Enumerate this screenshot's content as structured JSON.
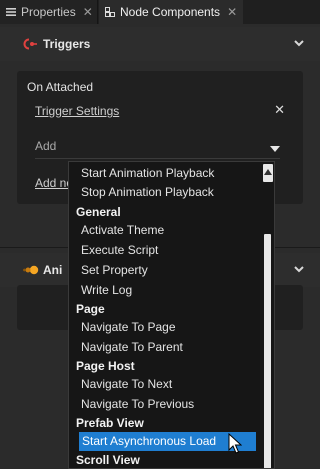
{
  "tabs": [
    {
      "label": "Properties",
      "close": "✕",
      "active": false
    },
    {
      "label": "Node Components",
      "close": "✕",
      "active": true
    }
  ],
  "triggers_section": {
    "title": "Triggers",
    "card": {
      "event": "On Attached",
      "trigger_settings_link": "Trigger Settings",
      "remove_glyph": "✕",
      "add_select_value": "Add",
      "add_link": "Add no"
    }
  },
  "animations_section": {
    "title": "Ani"
  },
  "dropdown": {
    "items": [
      {
        "kind": "item",
        "label": "Start Animation Playback"
      },
      {
        "kind": "item",
        "label": "Stop Animation Playback"
      },
      {
        "kind": "group",
        "label": "General"
      },
      {
        "kind": "item",
        "label": "Activate Theme"
      },
      {
        "kind": "item",
        "label": "Execute Script"
      },
      {
        "kind": "item",
        "label": "Set Property"
      },
      {
        "kind": "item",
        "label": "Write Log"
      },
      {
        "kind": "group",
        "label": "Page"
      },
      {
        "kind": "item",
        "label": "Navigate To Page"
      },
      {
        "kind": "item",
        "label": "Navigate To Parent"
      },
      {
        "kind": "group",
        "label": "Page Host"
      },
      {
        "kind": "item",
        "label": "Navigate To Next"
      },
      {
        "kind": "item",
        "label": "Navigate To Previous"
      },
      {
        "kind": "group",
        "label": "Prefab View"
      },
      {
        "kind": "item",
        "label": "Start Asynchronous Load",
        "selected": true
      },
      {
        "kind": "group",
        "label": "Scroll View"
      }
    ]
  },
  "colors": {
    "selection": "#1f7ed1",
    "trigger_icon": "#e0413f",
    "animation_icon": "#f5a623"
  }
}
